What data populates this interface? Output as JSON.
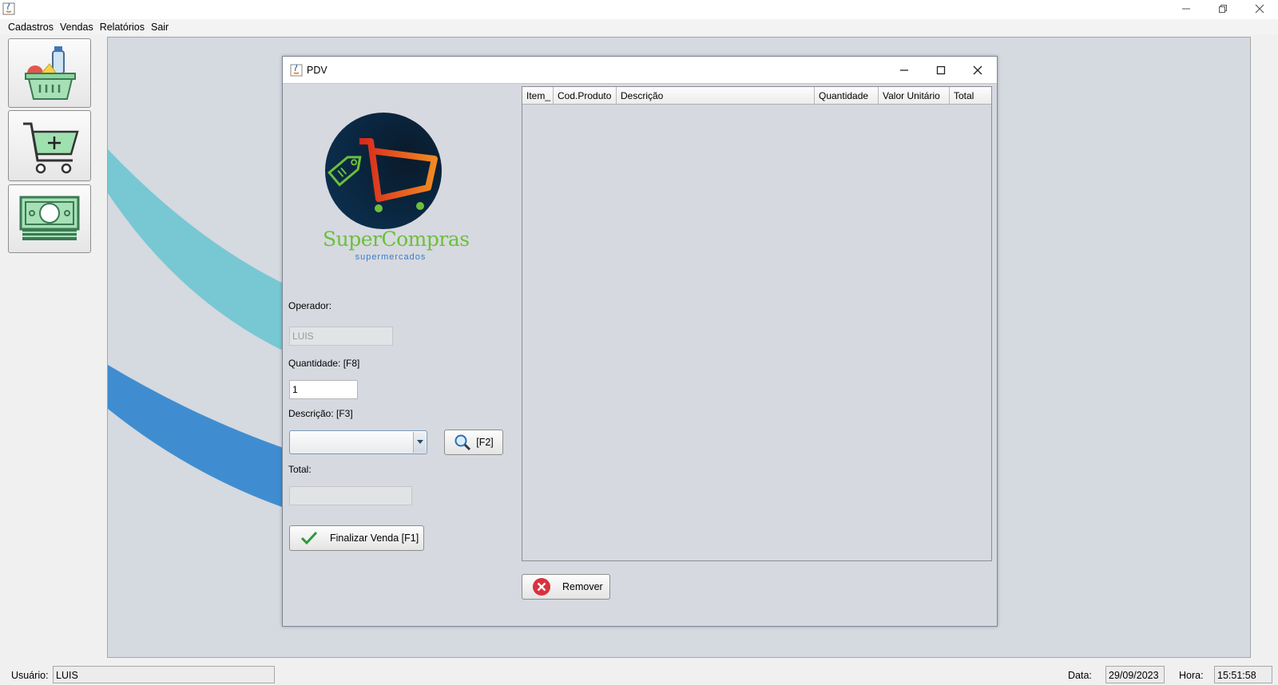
{
  "menubar": {
    "items": [
      "Cadastros",
      "Vendas",
      "Relatórios",
      "Sair"
    ]
  },
  "toolbar": {
    "buttons": [
      "grocery-basket-icon",
      "add-to-cart-icon",
      "money-icon"
    ]
  },
  "pdv": {
    "title": "PDV",
    "logo": {
      "text_main": "SuperCompras",
      "text_sub": "supermercados"
    },
    "operador": {
      "label": "Operador:",
      "value": "LUIS"
    },
    "quantidade": {
      "label": "Quantidade: [F8]",
      "value": "1"
    },
    "descricao": {
      "label": "Descrição: [F3]",
      "value": ""
    },
    "search_button": {
      "label": "[F2]"
    },
    "total": {
      "label": "Total:",
      "value": ""
    },
    "finalizar_button": {
      "label": "Finalizar Venda [F1]"
    },
    "table": {
      "columns": [
        "Item_",
        "Cod.Produto",
        "Descrição",
        "Quantidade",
        "Valor Unitário",
        "Total"
      ],
      "rows": []
    },
    "remover_button": {
      "label": "Remover"
    }
  },
  "statusbar": {
    "usuario_label": "Usuário:",
    "usuario_value": "LUIS",
    "data_label": "Data:",
    "data_value": "29/09/2023",
    "hora_label": "Hora:",
    "hora_value": "15:51:58"
  },
  "colors": {
    "wave_teal": "#77c8d3",
    "wave_blue": "#3f8dd0",
    "logo_green": "#6cbf3c",
    "logo_orange": "#e0651a"
  }
}
